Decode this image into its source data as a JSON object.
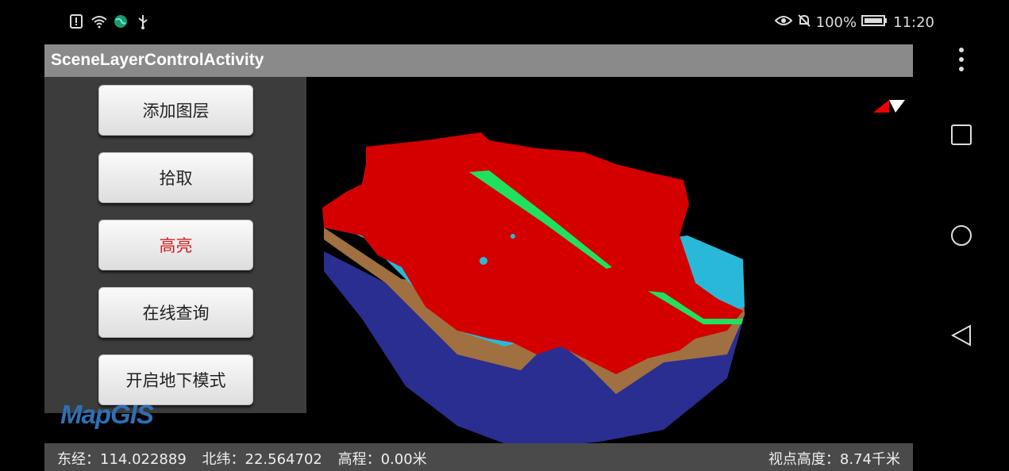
{
  "status_bar": {
    "left_icons": [
      "alert-icon",
      "wifi-icon",
      "globe-icon",
      "usb-icon"
    ],
    "right_icons": [
      "eye-icon",
      "bell-off-icon"
    ],
    "battery": "100%",
    "time": "11:20"
  },
  "app": {
    "title": "SceneLayerControlActivity",
    "buttons": [
      {
        "label": "添加图层"
      },
      {
        "label": "拾取"
      },
      {
        "label": "高亮"
      },
      {
        "label": "在线查询"
      },
      {
        "label": "开启地下模式"
      }
    ],
    "logo_text": "MapGIS",
    "status": {
      "longitude": "东经：114.022889",
      "latitude": "北纬：22.564702",
      "elevation": "高程：0.00米",
      "view_height": "视点高度：8.74千米"
    }
  },
  "nav_bar": {
    "icons": [
      "more-vert-icon",
      "recents-icon",
      "home-icon",
      "back-icon"
    ]
  },
  "colors": {
    "title_bar": "#8a8a8a",
    "highlight_text": "#d21f1f",
    "layer_top": "#d40000",
    "layer_cyan": "#2ab8d8",
    "layer_brown": "#a07040",
    "layer_blue": "#2a2e90",
    "layer_green": "#20e060"
  }
}
